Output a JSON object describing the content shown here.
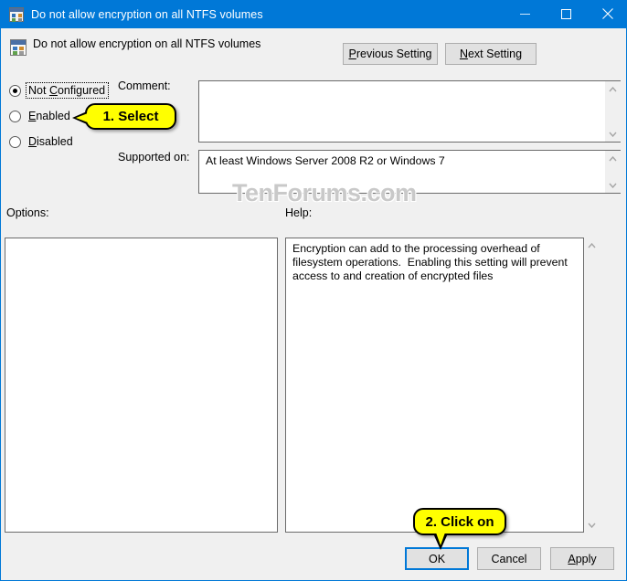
{
  "window": {
    "title": "Do not allow encryption on all NTFS volumes",
    "icon": "policy-setting-icon",
    "accent_color": "#0078d7",
    "controls": {
      "minimize": "minimize-icon",
      "maximize": "maximize-icon",
      "close": "close-icon"
    }
  },
  "header": {
    "title": "Do not allow encryption on all NTFS volumes",
    "previous_setting": "Previous Setting",
    "next_setting": "Next Setting"
  },
  "state": {
    "options": [
      {
        "label": "Not Configured",
        "selected": true,
        "focused": true
      },
      {
        "label": "Enabled",
        "selected": false,
        "focused": false
      },
      {
        "label": "Disabled",
        "selected": false,
        "focused": false
      }
    ]
  },
  "comment": {
    "label": "Comment:",
    "value": "",
    "placeholder": ""
  },
  "supported": {
    "label": "Supported on:",
    "value": "At least Windows Server 2008 R2 or Windows 7"
  },
  "options_panel": {
    "label": "Options:",
    "value": ""
  },
  "help_panel": {
    "label": "Help:",
    "value": "Encryption can add to the processing overhead of filesystem operations.  Enabling this setting will prevent access to and creation of encrypted files"
  },
  "footer": {
    "ok": "OK",
    "cancel": "Cancel",
    "apply": "Apply"
  },
  "watermark": {
    "text": "TenForums.com"
  },
  "annotations": [
    {
      "text": "1. Select",
      "points_to": "enabled-radio",
      "color": "#ffff00"
    },
    {
      "text": "2. Click on",
      "points_to": "ok-button",
      "color": "#ffff00"
    }
  ]
}
